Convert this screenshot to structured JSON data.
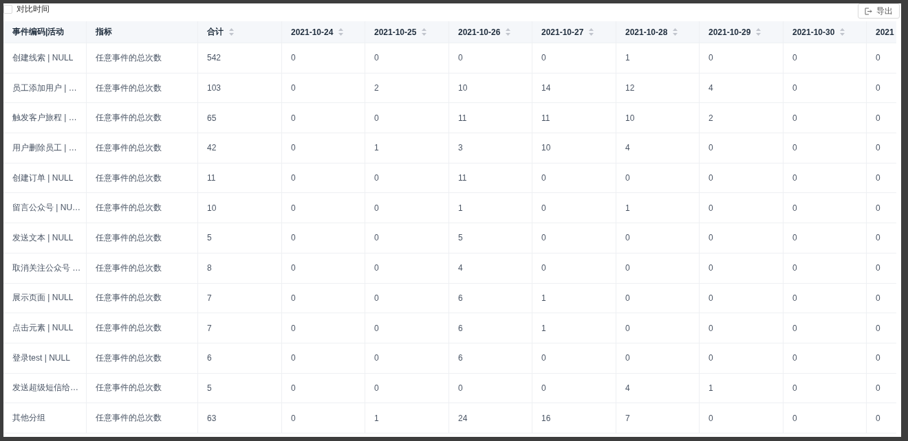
{
  "toolbar": {
    "compare": {
      "label": "对比时间",
      "checked": false
    },
    "export_button": "导出"
  },
  "table": {
    "columns": [
      {
        "label": "事件编码|活动",
        "sortable": false
      },
      {
        "label": "指标",
        "sortable": false
      },
      {
        "label": "合计",
        "sortable": true
      },
      {
        "label": "2021-10-24",
        "sortable": true
      },
      {
        "label": "2021-10-25",
        "sortable": true
      },
      {
        "label": "2021-10-26",
        "sortable": true
      },
      {
        "label": "2021-10-27",
        "sortable": true
      },
      {
        "label": "2021-10-28",
        "sortable": true
      },
      {
        "label": "2021-10-29",
        "sortable": true
      },
      {
        "label": "2021-10-30",
        "sortable": true
      },
      {
        "label": "2021"
      }
    ],
    "rows": [
      {
        "cells": [
          "创建线索 | NULL",
          "任意事件的总次数",
          "542",
          "0",
          "0",
          "0",
          "0",
          "1",
          "0",
          "0",
          "0"
        ]
      },
      {
        "cells": [
          "员工添加用户 | …",
          "任意事件的总次数",
          "103",
          "0",
          "2",
          "10",
          "14",
          "12",
          "4",
          "0",
          "0"
        ]
      },
      {
        "cells": [
          "触发客户旅程 | …",
          "任意事件的总次数",
          "65",
          "0",
          "0",
          "11",
          "11",
          "10",
          "2",
          "0",
          "0"
        ]
      },
      {
        "cells": [
          "用户删除员工 | …",
          "任意事件的总次数",
          "42",
          "0",
          "1",
          "3",
          "10",
          "4",
          "0",
          "0",
          "0"
        ]
      },
      {
        "cells": [
          "创建订单 | NULL",
          "任意事件的总次数",
          "11",
          "0",
          "0",
          "11",
          "0",
          "0",
          "0",
          "0",
          "0"
        ]
      },
      {
        "cells": [
          "留言公众号 | NU…",
          "任意事件的总次数",
          "10",
          "0",
          "0",
          "1",
          "0",
          "1",
          "0",
          "0",
          "0"
        ]
      },
      {
        "cells": [
          "发送文本 | NULL",
          "任意事件的总次数",
          "5",
          "0",
          "0",
          "5",
          "0",
          "0",
          "0",
          "0",
          "0"
        ]
      },
      {
        "cells": [
          "取消关注公众号 …",
          "任意事件的总次数",
          "8",
          "0",
          "0",
          "4",
          "0",
          "0",
          "0",
          "0",
          "0"
        ]
      },
      {
        "cells": [
          "展示页面 | NULL",
          "任意事件的总次数",
          "7",
          "0",
          "0",
          "6",
          "1",
          "0",
          "0",
          "0",
          "0"
        ]
      },
      {
        "cells": [
          "点击元素 | NULL",
          "任意事件的总次数",
          "7",
          "0",
          "0",
          "6",
          "1",
          "0",
          "0",
          "0",
          "0"
        ]
      },
      {
        "cells": [
          "登录test | NULL",
          "任意事件的总次数",
          "6",
          "0",
          "0",
          "6",
          "0",
          "0",
          "0",
          "0",
          "0"
        ]
      },
      {
        "cells": [
          "发送超级短信给…",
          "任意事件的总次数",
          "5",
          "0",
          "0",
          "0",
          "0",
          "4",
          "1",
          "0",
          "0"
        ]
      },
      {
        "cells": [
          "其他分组",
          "任意事件的总次数",
          "63",
          "0",
          "1",
          "24",
          "16",
          "7",
          "0",
          "0",
          "0"
        ]
      }
    ]
  }
}
